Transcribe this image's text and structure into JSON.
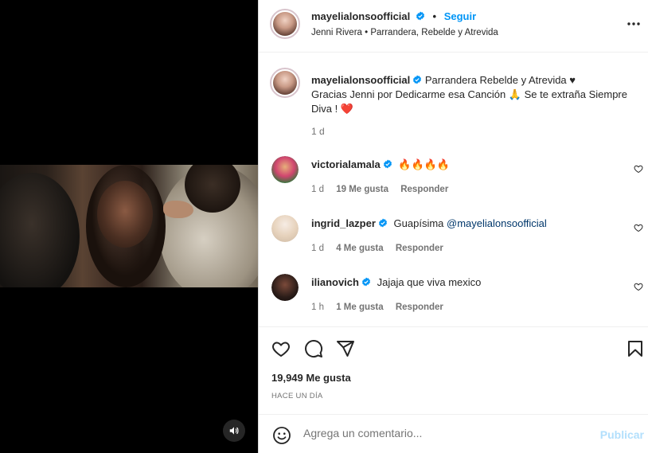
{
  "post": {
    "username": "mayelialonsoofficial",
    "follow_label": "Seguir",
    "audio": "Jenni Rivera • Parrandera, Rebelde y Atrevida",
    "more_label": "•••"
  },
  "caption": {
    "username": "mayelialonsoofficial",
    "text_line1": "Parrandera Rebelde y Atrevida ♥",
    "text_line2": "Gracias Jenni por Dedicarme esa Canción 🙏 Se te extraña Siempre",
    "text_line3": "Diva ! ❤️",
    "time": "1 d"
  },
  "comments": [
    {
      "username": "victorialamala",
      "text": "🔥🔥🔥🔥",
      "time": "1 d",
      "likes": "19 Me gusta",
      "reply": "Responder"
    },
    {
      "username": "ingrid_lazper",
      "text": "Guapísima ",
      "mention": "@mayelialonsoofficial",
      "time": "1 d",
      "likes": "4 Me gusta",
      "reply": "Responder"
    },
    {
      "username": "ilianovich",
      "text": "Jajaja que viva mexico",
      "time": "1 h",
      "likes": "1 Me gusta",
      "reply": "Responder"
    }
  ],
  "stats": {
    "likes": "19,949 Me gusta",
    "date": "HACE UN DÍA"
  },
  "composer": {
    "placeholder": "Agrega un comentario...",
    "publish": "Publicar"
  },
  "colors": {
    "accent": "#0095f6",
    "verified": "#0095f6",
    "publish_disabled": "#b2dffc"
  }
}
